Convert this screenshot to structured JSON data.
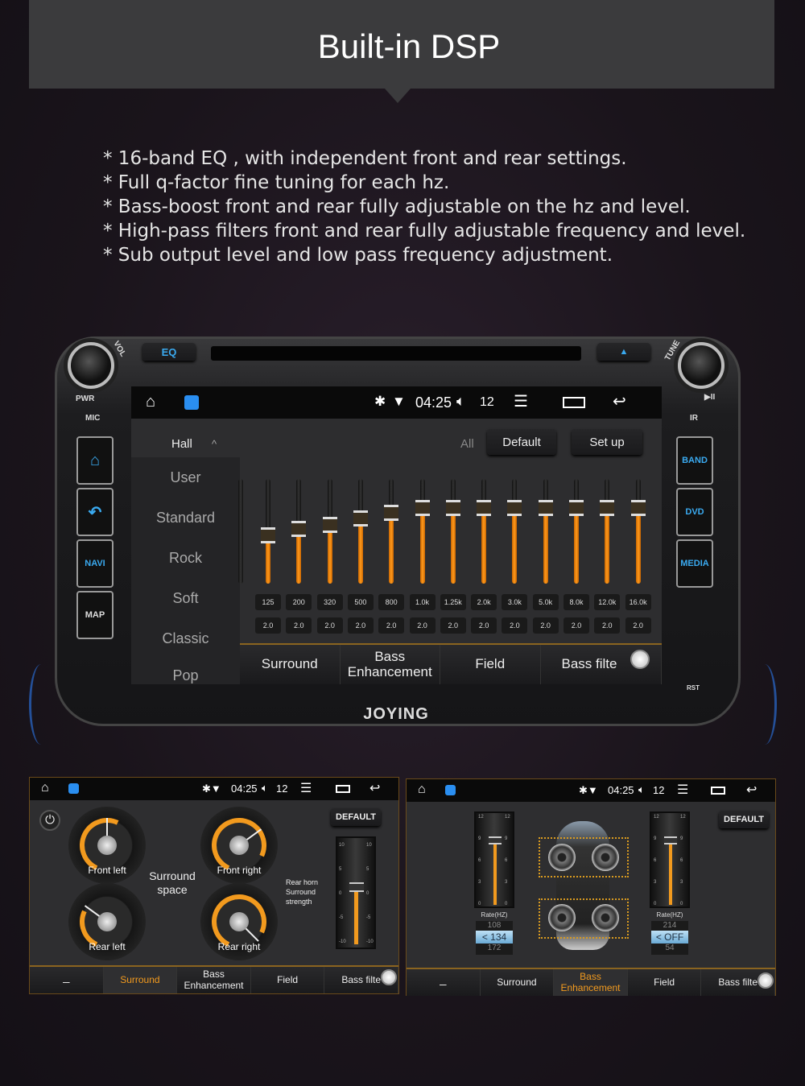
{
  "header": {
    "title": "Built-in DSP"
  },
  "bullets": [
    "* 16-band EQ , with independent front and rear settings.",
    "* Full q-factor fine tuning for each hz.",
    "* Bass-boost front and rear fully adjustable on the hz and level.",
    "* High-pass filters front and rear fully adjustable frequency and level.",
    "* Sub output level and  low pass frequency adjustment."
  ],
  "colors": {
    "accent": "#f29a1e",
    "side_button_text": "#3aaaf0",
    "background": "#1a141b"
  },
  "head_unit": {
    "brand": "JOYING",
    "top": {
      "eq": "EQ",
      "eject_icon": "eject-icon"
    },
    "labels": {
      "pwr": "PWR",
      "mic": "MIC",
      "vol": "VOL",
      "tune": "TUNE",
      "ir": "IR",
      "rst": "RST",
      "play_pause": "▶II"
    },
    "left_buttons": [
      {
        "icon": "home-icon",
        "label": "⌂"
      },
      {
        "icon": "back-icon",
        "label": "↶"
      },
      {
        "label": "NAVI"
      },
      {
        "label": "MAP"
      }
    ],
    "right_buttons": [
      {
        "label": "BAND"
      },
      {
        "label": "DVD"
      },
      {
        "label": "MEDIA"
      }
    ]
  },
  "status": {
    "time": "04:25",
    "volume": "12",
    "icons": [
      "home-icon",
      "app-icon",
      "bluetooth-icon",
      "wifi-icon",
      "volume-icon",
      "menu-icon",
      "recent-apps-icon",
      "back-icon"
    ]
  },
  "eq": {
    "preset": "Hall",
    "all_label": "All",
    "default_label": "Default",
    "setup_label": "Set up",
    "presets": [
      "User",
      "Standard",
      "Rock",
      "Soft",
      "Classic",
      "Pop"
    ],
    "bands": [
      {
        "freq": "125",
        "q": "2.0",
        "level": 0.46
      },
      {
        "freq": "200",
        "q": "2.0",
        "level": 0.52
      },
      {
        "freq": "320",
        "q": "2.0",
        "level": 0.56
      },
      {
        "freq": "500",
        "q": "2.0",
        "level": 0.62
      },
      {
        "freq": "800",
        "q": "2.0",
        "level": 0.68
      },
      {
        "freq": "1.0k",
        "q": "2.0",
        "level": 0.72
      },
      {
        "freq": "1.25k",
        "q": "2.0",
        "level": 0.72
      },
      {
        "freq": "2.0k",
        "q": "2.0",
        "level": 0.72
      },
      {
        "freq": "3.0k",
        "q": "2.0",
        "level": 0.72
      },
      {
        "freq": "5.0k",
        "q": "2.0",
        "level": 0.72
      },
      {
        "freq": "8.0k",
        "q": "2.0",
        "level": 0.72
      },
      {
        "freq": "12.0k",
        "q": "2.0",
        "level": 0.72
      },
      {
        "freq": "16.0k",
        "q": "2.0",
        "level": 0.72
      }
    ],
    "tabs": [
      "Surround",
      "Bass\nEnhancement",
      "Field",
      "Bass filte"
    ]
  },
  "surround_panel": {
    "default_label": "DEFAULT",
    "center_label": "Surround\nspace",
    "dials": [
      {
        "label": "Front left",
        "value": 50
      },
      {
        "label": "Front right",
        "value": 70
      },
      {
        "label": "Rear left",
        "value": 30
      },
      {
        "label": "Rear right",
        "value": 100
      }
    ],
    "slider_label": "Rear horn\nSurround\nstrength",
    "slider_scale": [
      "10",
      "5",
      "0",
      "-5",
      "-10"
    ],
    "slider_value": 2,
    "tabs": [
      "Surround",
      "Bass\nEnhancement",
      "Field",
      "Bass filte"
    ],
    "active_tab": "Surround"
  },
  "bass_panel": {
    "default_label": "DEFAULT",
    "rate_label": "Rate(HZ)",
    "scale": [
      "12",
      "9",
      "6",
      "3",
      "0"
    ],
    "left": {
      "level": 9,
      "above": "108",
      "selected": "< 134",
      "below": "172"
    },
    "right": {
      "level": 9,
      "above": "214",
      "selected": "< OFF",
      "below": "54"
    },
    "tabs": [
      "Surround",
      "Bass\nEnhancement",
      "Field",
      "Bass filte"
    ],
    "active_tab": "Bass Enhancement"
  }
}
